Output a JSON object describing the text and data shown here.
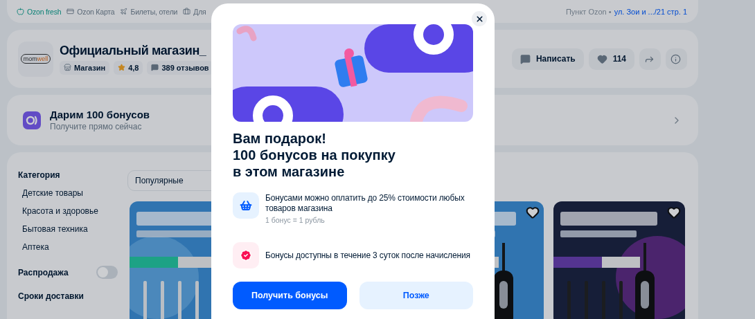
{
  "top_nav": {
    "links": [
      {
        "kind": "fresh",
        "label": "Ozon fresh"
      },
      {
        "kind": "card",
        "label": "Ozon Карта"
      },
      {
        "kind": "travel",
        "label": "Билеты, отели"
      },
      {
        "kind": "business",
        "label": "Для"
      }
    ],
    "pickup": {
      "label": "Пункт Ozon •",
      "address": "ул. Зои и .../21 стр. 1"
    }
  },
  "store": {
    "logo": [
      "mom",
      "well"
    ],
    "name": "Официальный магазин_",
    "chips": [
      {
        "kind": "shop",
        "label": "Магазин"
      },
      {
        "kind": "rating",
        "label": "4,8"
      },
      {
        "kind": "reviews",
        "label": "389 отзывов"
      }
    ],
    "actions": [
      {
        "kind": "write",
        "label": "Написать"
      },
      {
        "kind": "like",
        "label": "114"
      },
      {
        "kind": "share"
      },
      {
        "kind": "info"
      }
    ]
  },
  "promo": {
    "title": "Дарим 100 бонусов",
    "subtitle": "Получите прямо сейчас"
  },
  "filters": {
    "category_title": "Категория",
    "categories": [
      "Детские товары",
      "Красота и здоровье",
      "Бытовая техника",
      "Аптека"
    ],
    "sale": {
      "label": "Распродажа",
      "on": false
    },
    "delivery_title": "Сроки доставки"
  },
  "sort": {
    "value": "Популярные"
  },
  "modal": {
    "title_lines": [
      "Вам подарок!",
      "100 бонусов на покупку",
      "в этом магазине"
    ],
    "features": [
      {
        "kind": "basket",
        "text": "Бонусами можно оплатить до 25% стоимости любых товаров магазина",
        "note": "1 бонус = 1 рубль"
      },
      {
        "kind": "timer",
        "text": "Бонусы доступны в течение 3 суток после начисления"
      }
    ],
    "buttons": [
      {
        "kind": "primary",
        "label": "Получить бонусы"
      },
      {
        "kind": "secondary",
        "label": "Позже"
      }
    ]
  }
}
